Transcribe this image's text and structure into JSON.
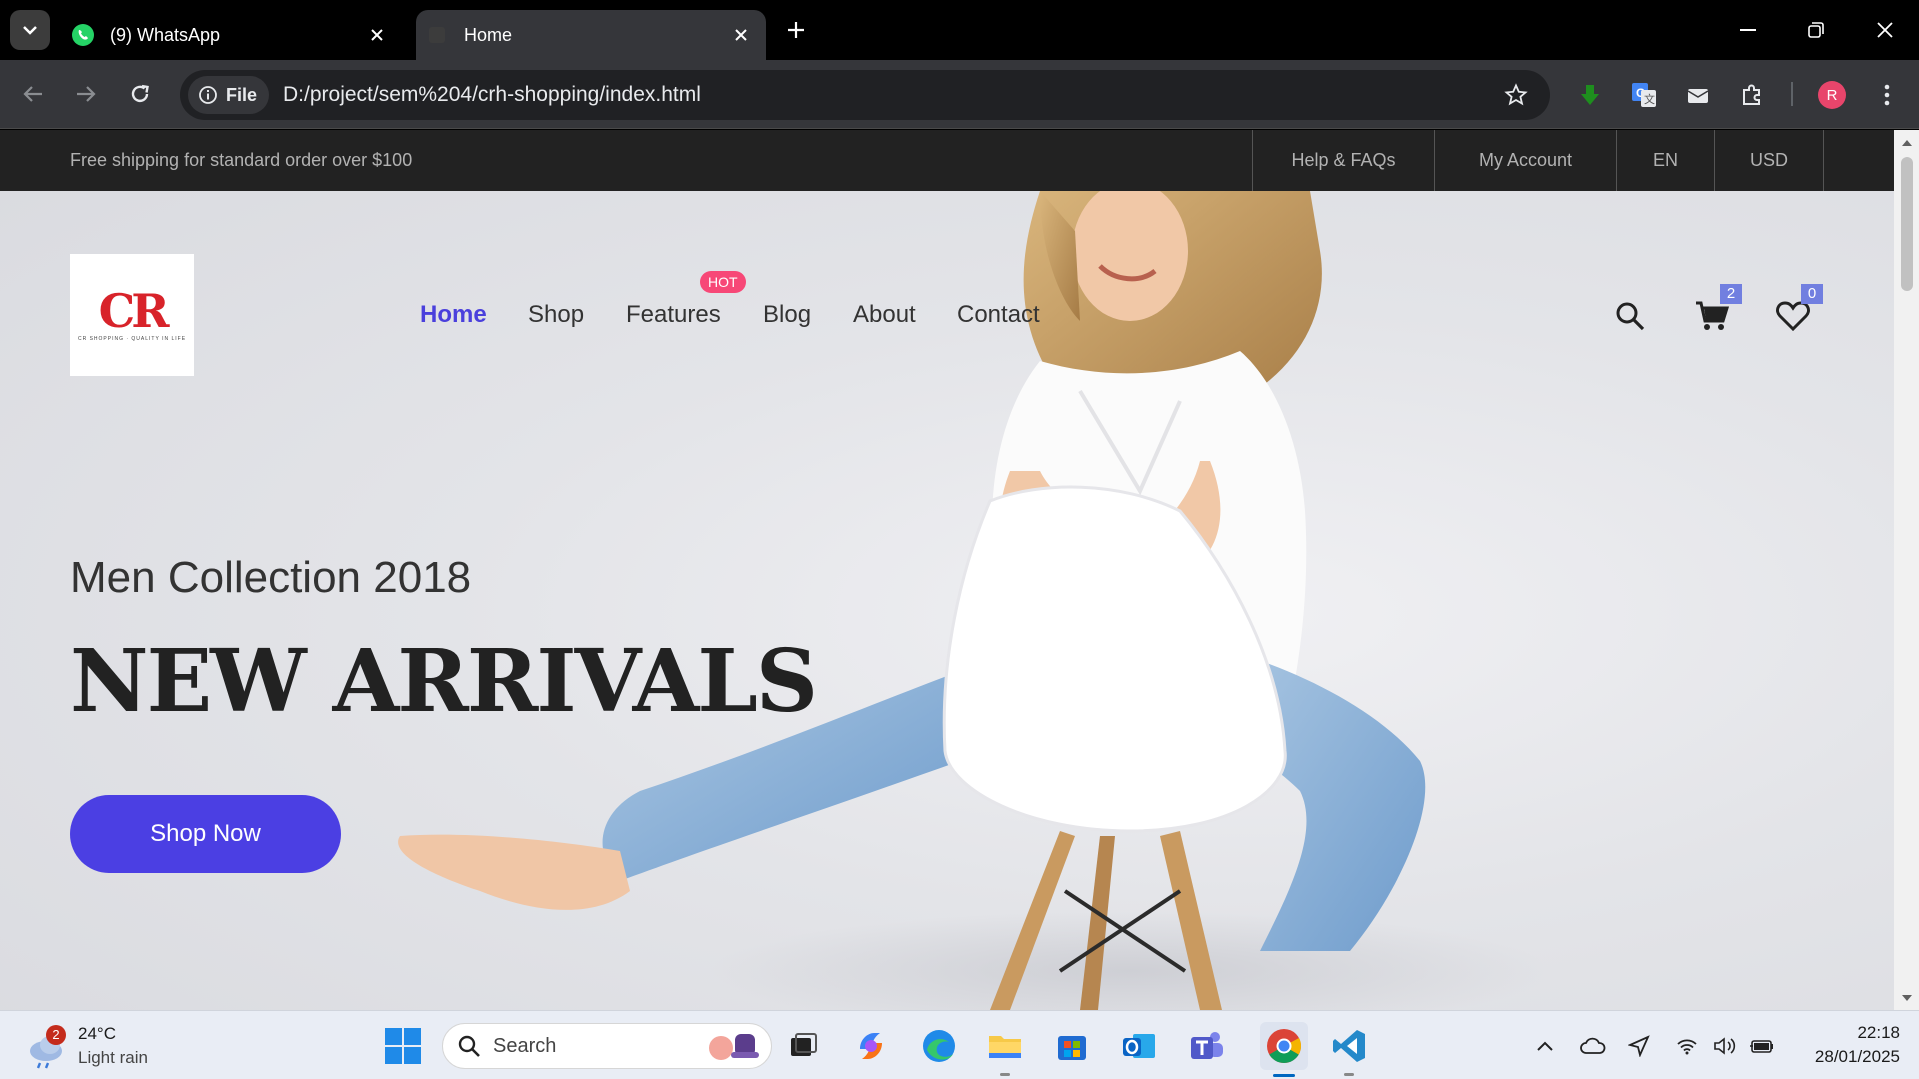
{
  "browser": {
    "tabs": [
      {
        "title": "(9) WhatsApp",
        "active": false,
        "favicon": "whatsapp-icon"
      },
      {
        "title": "Home",
        "active": true,
        "favicon": "page-icon"
      }
    ],
    "site_chip": "File",
    "url": "D:/project/sem%204/crh-shopping/index.html",
    "profile_initial": "R"
  },
  "site": {
    "topbar": {
      "shipping_text": "Free shipping for standard order over $100",
      "links": [
        "Help & FAQs",
        "My Account",
        "EN",
        "USD"
      ]
    },
    "logo": {
      "letters": "CR",
      "tagline": "CR SHOPPING · QUALITY IN LIFE"
    },
    "nav": [
      {
        "label": "Home",
        "active": true
      },
      {
        "label": "Shop"
      },
      {
        "label": "Features",
        "badge": "HOT"
      },
      {
        "label": "Blog"
      },
      {
        "label": "About"
      },
      {
        "label": "Contact"
      }
    ],
    "cart_count": "2",
    "wishlist_count": "0",
    "hero": {
      "subtitle": "Men Collection 2018",
      "headline": "NEW ARRIVALS",
      "button": "Shop Now"
    },
    "accent": "#4b3fe3"
  },
  "taskbar": {
    "weather": {
      "temp": "24°C",
      "condition": "Light rain",
      "badge": "2"
    },
    "search_placeholder": "Search",
    "time": "22:18",
    "date": "28/01/2025"
  }
}
